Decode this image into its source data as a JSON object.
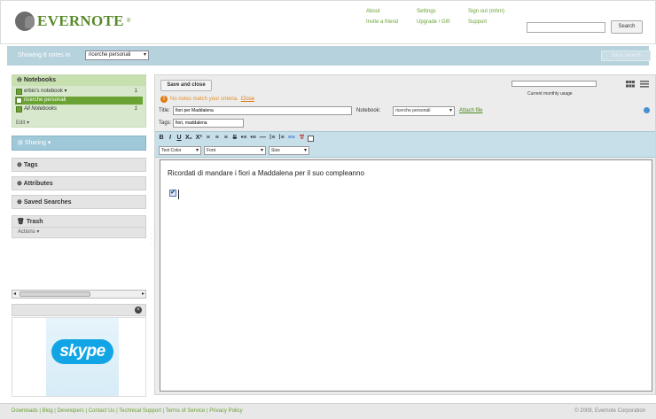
{
  "header": {
    "logo_text": "EVERNOTE",
    "logo_tm": "®",
    "links": [
      {
        "label": "About"
      },
      {
        "label": "Settings"
      },
      {
        "label": "Sign out (mhm)"
      },
      {
        "label": "Invite a friend"
      },
      {
        "label": "Upgrade / Gift"
      },
      {
        "label": "Support"
      }
    ],
    "search_value": "",
    "search_button": "Search"
  },
  "showbar": {
    "text": "Showing 8 notes in",
    "notebook": "ricerche personali",
    "save_search": "Save search"
  },
  "sidebar": {
    "notebooks_title": "Notebooks",
    "notebooks": [
      {
        "label": "erbio's notebook ▾",
        "count": "1"
      },
      {
        "label": "ricerche personali",
        "count": ""
      },
      {
        "label": "All Notebooks",
        "count": "1"
      }
    ],
    "notebooks_edit": "Edit ▾",
    "sharing": "Sharing ▾",
    "tags": "Tags",
    "attributes": "Attributes",
    "saved_searches": "Saved Searches",
    "trash": "Trash",
    "trash_actions": "Actions ▾",
    "ad_brand": "skype"
  },
  "editor": {
    "save_close": "Save and close",
    "usage_label": "Current monthly usage",
    "warning": "No notes match your criteria.",
    "warning_close": "Close",
    "title_label": "Title:",
    "title_value": "fiori per Maddalena",
    "notebook_label": "Notebook:",
    "notebook_value": "ricerche personali",
    "attach_label": "Attach file",
    "tags_label": "Tags:",
    "tags_value": "fiori, maddalena",
    "format_buttons": [
      "B",
      "I",
      "U",
      "X₂",
      "X²",
      "≡",
      "≡",
      "≡",
      "S",
      "•≡",
      "•≡",
      "—",
      "⁞≡",
      "⁞≡",
      "≡≡",
      "T̸"
    ],
    "text_color_label": "Text Color",
    "font_label": "Font",
    "size_label": "Size",
    "body_text": "Ricordati di mandare i fiori a Maddalena per il suo compleanno",
    "check_glyph": "✔"
  },
  "footer": {
    "links": "Downloads | Blog | Developers | Contact Us | Technical Support | Terms of Service | Privacy Policy",
    "copyright": "© 2009, Evernote Corporation"
  }
}
